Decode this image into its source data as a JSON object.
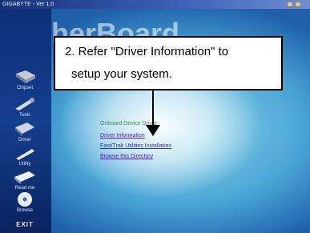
{
  "window": {
    "title": "GIGABYTE - Ver 1.0",
    "header_text": "MotherBoard"
  },
  "sidebar": {
    "items": [
      {
        "label": "Chipset",
        "icon": "chip-icon"
      },
      {
        "label": "Tools",
        "icon": "tool-icon"
      },
      {
        "label": "Driver",
        "icon": "disk-icon"
      },
      {
        "label": "Utility",
        "icon": "pencil-icon"
      },
      {
        "label": "Read me",
        "icon": "book-icon"
      },
      {
        "label": "Browse",
        "icon": "cd-icon"
      }
    ],
    "exit_label": "EXIT"
  },
  "callout": {
    "line1": "2. Refer \"Driver Information\" to",
    "line2": "setup your system."
  },
  "menu": {
    "heading": "Onboard Device Driver :",
    "links": [
      "Driver Information",
      "Fast/Trak Utilities Installation",
      "Browse this Directory"
    ]
  },
  "colors": {
    "accent": "#3e2ab5",
    "heading": "#2f9c3b",
    "sidebar": "#153e8c"
  }
}
